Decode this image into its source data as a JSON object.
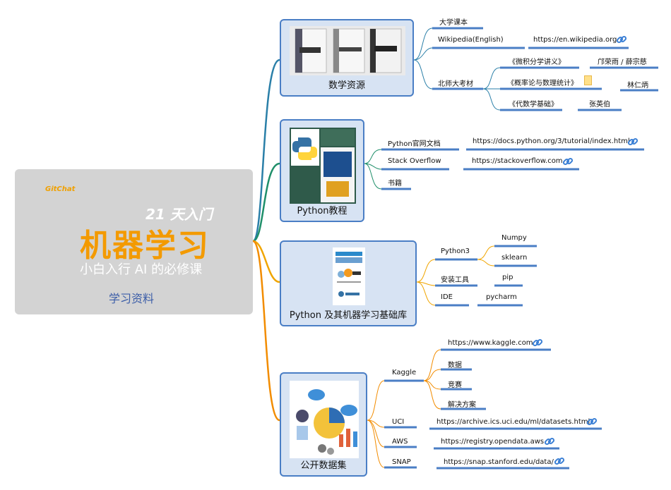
{
  "root": {
    "brand": "GitChat",
    "days": "21 天入门",
    "title": "机器学习",
    "slogan": "小白入行 AI 的必修课",
    "label": "学习资料"
  },
  "colors": {
    "math": "#2a7fa8",
    "python": "#1f8f6a",
    "libs": "#f0a500",
    "data": "#f28c00",
    "leaf_line": "#4a7ec5"
  },
  "topics": {
    "math": {
      "label": "数学资源",
      "items": {
        "textbook": "大学课本",
        "wiki": "Wikipedia(English)",
        "wiki_url": "https://en.wikipedia.org",
        "bnu": "北师大考材",
        "book1": "《微积分学讲义》",
        "book1_author": "邝荣雨 / 薛宗慈",
        "book2": "《概率论与数理统计》",
        "book2_author": "林仁炳",
        "book3": "《代数学基础》",
        "book3_author": "张英伯"
      }
    },
    "python": {
      "label": "Python教程",
      "items": {
        "docs": "Python官网文档",
        "docs_url": "https://docs.python.org/3/tutorial/index.html",
        "so": "Stack Overflow",
        "so_url": "https://stackoverflow.com",
        "books": "书籍"
      }
    },
    "libs": {
      "label": "Python 及其机器学习基础库",
      "items": {
        "py3": "Python3",
        "numpy": "Numpy",
        "sklearn": "sklearn",
        "install": "安装工具",
        "pip": "pip",
        "ide": "IDE",
        "pycharm": "pycharm"
      }
    },
    "data": {
      "label": "公开数据集",
      "items": {
        "kaggle": "Kaggle",
        "kaggle_url": "https://www.kaggle.com",
        "k_data": "数据",
        "k_comp": "竞赛",
        "k_sol": "解决方案",
        "uci": "UCI",
        "uci_url": "https://archive.ics.uci.edu/ml/datasets.html",
        "aws": "AWS",
        "aws_url": "https://registry.opendata.aws",
        "snap": "SNAP",
        "snap_url": "https://snap.stanford.edu/data/"
      }
    }
  }
}
